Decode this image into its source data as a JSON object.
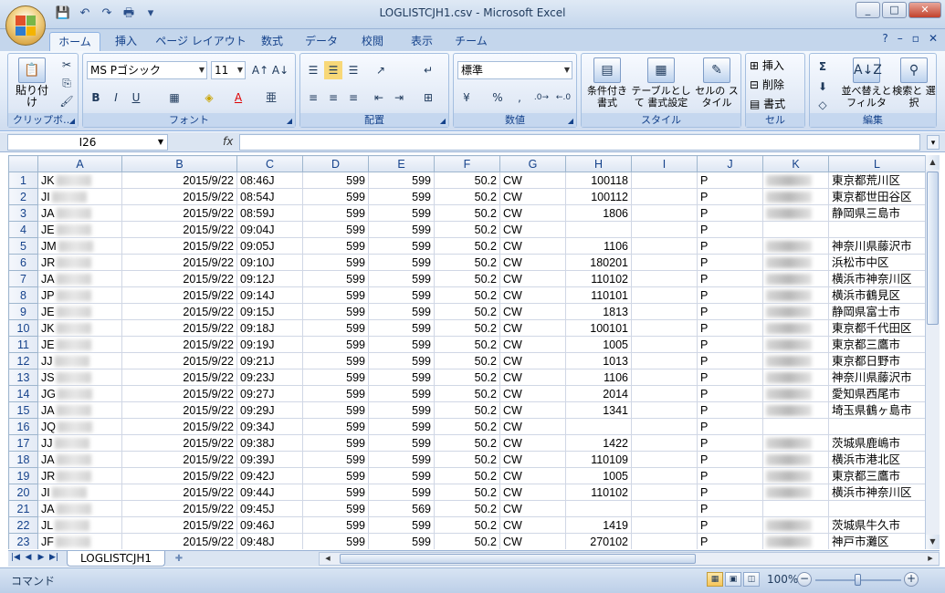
{
  "window": {
    "title": "LOGLISTCJH1.csv - Microsoft Excel",
    "controls": [
      "_",
      "□",
      "✕"
    ]
  },
  "qat": [
    "💾",
    "↶",
    "↷",
    "🖶",
    "▾"
  ],
  "ribbon": {
    "tabs": [
      "ホーム",
      "挿入",
      "ページ レイアウト",
      "数式",
      "データ",
      "校閲",
      "表示",
      "チーム"
    ],
    "active_tab": "ホーム",
    "help": [
      "?",
      "–",
      "▫",
      "✕"
    ],
    "clipboard": {
      "label": "クリップボ…",
      "paste": "貼り付け"
    },
    "font": {
      "label": "フォント",
      "name": "MS Pゴシック",
      "size": "11"
    },
    "alignment": {
      "label": "配置"
    },
    "number": {
      "label": "数値",
      "format": "標準",
      "percent": "%",
      "comma": ","
    },
    "styles": {
      "label": "スタイル",
      "conditional": "条件付き 書式",
      "table": "テーブルとして 書式設定",
      "cell": "セルの スタイル"
    },
    "cells": {
      "label": "セル",
      "insert": "挿入",
      "delete": "削除",
      "format": "書式"
    },
    "editing": {
      "label": "編集",
      "sort": "並べ替えと フィルタ",
      "find": "検索と 選択",
      "sigma": "Σ"
    }
  },
  "formula_bar": {
    "name_box": "I26",
    "fx": "fx",
    "value": ""
  },
  "grid": {
    "columns": [
      "A",
      "B",
      "C",
      "D",
      "E",
      "F",
      "G",
      "H",
      "I",
      "J",
      "K",
      "L"
    ],
    "rows": [
      {
        "n": "1",
        "a": "JK",
        "b": "2015/9/22",
        "c": "08:46J",
        "d": "599",
        "e": "599",
        "f": "50.2",
        "g": "CW",
        "h": "100118",
        "i": "",
        "j": "P",
        "k": "",
        "l": "東京都荒川区"
      },
      {
        "n": "2",
        "a": "JI",
        "b": "2015/9/22",
        "c": "08:54J",
        "d": "599",
        "e": "599",
        "f": "50.2",
        "g": "CW",
        "h": "100112",
        "i": "",
        "j": "P",
        "k": "",
        "l": "東京都世田谷区"
      },
      {
        "n": "3",
        "a": "JA",
        "b": "2015/9/22",
        "c": "08:59J",
        "d": "599",
        "e": "599",
        "f": "50.2",
        "g": "CW",
        "h": "1806",
        "i": "",
        "j": "P",
        "k": "",
        "l": "静岡県三島市"
      },
      {
        "n": "4",
        "a": "JE",
        "b": "2015/9/22",
        "c": "09:04J",
        "d": "599",
        "e": "599",
        "f": "50.2",
        "g": "CW",
        "h": "",
        "i": "",
        "j": "P",
        "k": "",
        "l": ""
      },
      {
        "n": "5",
        "a": "JM",
        "b": "2015/9/22",
        "c": "09:05J",
        "d": "599",
        "e": "599",
        "f": "50.2",
        "g": "CW",
        "h": "1106",
        "i": "",
        "j": "P",
        "k": "",
        "l": "神奈川県藤沢市"
      },
      {
        "n": "6",
        "a": "JR",
        "b": "2015/9/22",
        "c": "09:10J",
        "d": "599",
        "e": "599",
        "f": "50.2",
        "g": "CW",
        "h": "180201",
        "i": "",
        "j": "P",
        "k": "",
        "l": "浜松市中区"
      },
      {
        "n": "7",
        "a": "JA",
        "b": "2015/9/22",
        "c": "09:12J",
        "d": "599",
        "e": "599",
        "f": "50.2",
        "g": "CW",
        "h": "110102",
        "i": "",
        "j": "P",
        "k": "",
        "l": "横浜市神奈川区"
      },
      {
        "n": "8",
        "a": "JP",
        "b": "2015/9/22",
        "c": "09:14J",
        "d": "599",
        "e": "599",
        "f": "50.2",
        "g": "CW",
        "h": "110101",
        "i": "",
        "j": "P",
        "k": "",
        "l": "横浜市鶴見区"
      },
      {
        "n": "9",
        "a": "JE",
        "b": "2015/9/22",
        "c": "09:15J",
        "d": "599",
        "e": "599",
        "f": "50.2",
        "g": "CW",
        "h": "1813",
        "i": "",
        "j": "P",
        "k": "",
        "l": "静岡県富士市"
      },
      {
        "n": "10",
        "a": "JK",
        "b": "2015/9/22",
        "c": "09:18J",
        "d": "599",
        "e": "599",
        "f": "50.2",
        "g": "CW",
        "h": "100101",
        "i": "",
        "j": "P",
        "k": "",
        "l": "東京都千代田区"
      },
      {
        "n": "11",
        "a": "JE",
        "b": "2015/9/22",
        "c": "09:19J",
        "d": "599",
        "e": "599",
        "f": "50.2",
        "g": "CW",
        "h": "1005",
        "i": "",
        "j": "P",
        "k": "",
        "l": "東京都三鷹市"
      },
      {
        "n": "12",
        "a": "JJ",
        "b": "2015/9/22",
        "c": "09:21J",
        "d": "599",
        "e": "599",
        "f": "50.2",
        "g": "CW",
        "h": "1013",
        "i": "",
        "j": "P",
        "k": "",
        "l": "東京都日野市"
      },
      {
        "n": "13",
        "a": "JS",
        "b": "2015/9/22",
        "c": "09:23J",
        "d": "599",
        "e": "599",
        "f": "50.2",
        "g": "CW",
        "h": "1106",
        "i": "",
        "j": "P",
        "k": "",
        "l": "神奈川県藤沢市"
      },
      {
        "n": "14",
        "a": "JG",
        "b": "2015/9/22",
        "c": "09:27J",
        "d": "599",
        "e": "599",
        "f": "50.2",
        "g": "CW",
        "h": "2014",
        "i": "",
        "j": "P",
        "k": "",
        "l": "愛知県西尾市"
      },
      {
        "n": "15",
        "a": "JA",
        "b": "2015/9/22",
        "c": "09:29J",
        "d": "599",
        "e": "599",
        "f": "50.2",
        "g": "CW",
        "h": "1341",
        "i": "",
        "j": "P",
        "k": "",
        "l": "埼玉県鶴ヶ島市"
      },
      {
        "n": "16",
        "a": "JQ",
        "b": "2015/9/22",
        "c": "09:34J",
        "d": "599",
        "e": "599",
        "f": "50.2",
        "g": "CW",
        "h": "",
        "i": "",
        "j": "P",
        "k": "",
        "l": ""
      },
      {
        "n": "17",
        "a": "JJ",
        "b": "2015/9/22",
        "c": "09:38J",
        "d": "599",
        "e": "599",
        "f": "50.2",
        "g": "CW",
        "h": "1422",
        "i": "",
        "j": "P",
        "k": "",
        "l": "茨城県鹿嶋市"
      },
      {
        "n": "18",
        "a": "JA",
        "b": "2015/9/22",
        "c": "09:39J",
        "d": "599",
        "e": "599",
        "f": "50.2",
        "g": "CW",
        "h": "110109",
        "i": "",
        "j": "P",
        "k": "",
        "l": "横浜市港北区"
      },
      {
        "n": "19",
        "a": "JR",
        "b": "2015/9/22",
        "c": "09:42J",
        "d": "599",
        "e": "599",
        "f": "50.2",
        "g": "CW",
        "h": "1005",
        "i": "",
        "j": "P",
        "k": "",
        "l": "東京都三鷹市"
      },
      {
        "n": "20",
        "a": "JI",
        "b": "2015/9/22",
        "c": "09:44J",
        "d": "599",
        "e": "599",
        "f": "50.2",
        "g": "CW",
        "h": "110102",
        "i": "",
        "j": "P",
        "k": "",
        "l": "横浜市神奈川区"
      },
      {
        "n": "21",
        "a": "JA",
        "b": "2015/9/22",
        "c": "09:45J",
        "d": "599",
        "e": "569",
        "f": "50.2",
        "g": "CW",
        "h": "",
        "i": "",
        "j": "P",
        "k": "",
        "l": ""
      },
      {
        "n": "22",
        "a": "JL",
        "b": "2015/9/22",
        "c": "09:46J",
        "d": "599",
        "e": "599",
        "f": "50.2",
        "g": "CW",
        "h": "1419",
        "i": "",
        "j": "P",
        "k": "",
        "l": "茨城県牛久市"
      },
      {
        "n": "23",
        "a": "JF",
        "b": "2015/9/22",
        "c": "09:48J",
        "d": "599",
        "e": "599",
        "f": "50.2",
        "g": "CW",
        "h": "270102",
        "i": "",
        "j": "P",
        "k": "",
        "l": "神戸市灘区"
      }
    ]
  },
  "sheet": {
    "tab": "LOGLISTCJH1"
  },
  "status": {
    "mode": "コマンド",
    "zoom": "100%",
    "minus": "−",
    "plus": "+"
  }
}
